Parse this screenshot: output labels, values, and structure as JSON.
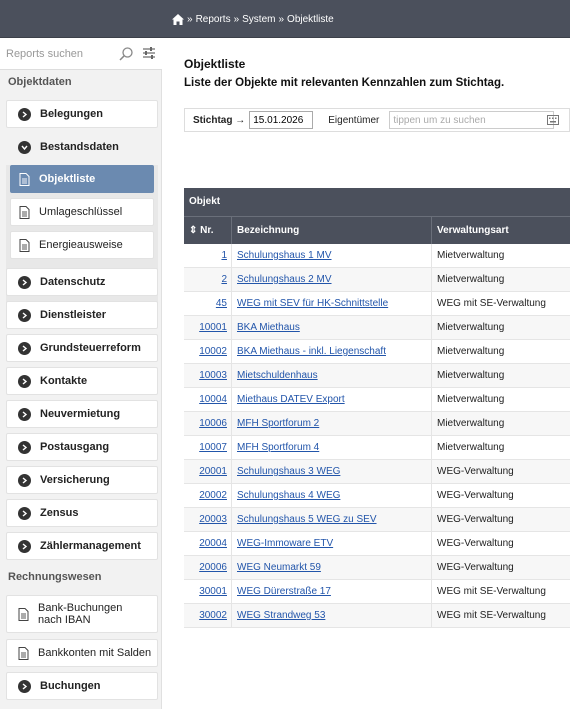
{
  "breadcrumb": {
    "items": [
      "Reports",
      "System",
      "Objektliste"
    ]
  },
  "sidebar": {
    "search_placeholder": "Reports suchen",
    "sections": {
      "objektdaten": "Objektdaten",
      "rechnungswesen": "Rechnungswesen"
    },
    "items": {
      "belegungen": "Belegungen",
      "bestandsdaten": "Bestandsdaten",
      "objektliste": "Objektliste",
      "umlageschluessel": "Umlageschlüssel",
      "energieausweise": "Energieausweise",
      "datenschutz": "Datenschutz",
      "dienstleister": "Dienstleister",
      "grundsteuerreform": "Grundsteuerreform",
      "kontakte": "Kontakte",
      "neuvermietung": "Neuvermietung",
      "postausgang": "Postausgang",
      "versicherung": "Versicherung",
      "zensus": "Zensus",
      "zaehlermanagement": "Zählermanagement",
      "bank_buchungen": "Bank-Buchungen nach IBAN",
      "bankkonten": "Bankkonten mit Salden",
      "buchungen": "Buchungen"
    }
  },
  "main": {
    "title": "Objektliste",
    "subtitle": "Liste der Objekte mit relevanten Kennzahlen zum Stichtag.",
    "filter": {
      "stichtag_label": "Stichtag →",
      "stichtag_value": "15.01.2026",
      "eigentuemer_label": "Eigentümer",
      "eigentuemer_placeholder": "tippen um zu suchen"
    },
    "table": {
      "group_label": "Objekt",
      "columns": [
        "⇕ Nr.",
        "Bezeichnung",
        "Verwaltungsart"
      ],
      "rows": [
        {
          "nr": "1",
          "name": "Schulungshaus 1 MV",
          "art": "Mietverwaltung"
        },
        {
          "nr": "2",
          "name": "Schulungshaus 2 MV",
          "art": "Mietverwaltung"
        },
        {
          "nr": "45",
          "name": "WEG mit SEV für HK-Schnittstelle",
          "art": "WEG mit SE-Verwaltung"
        },
        {
          "nr": "10001",
          "name": "BKA Miethaus",
          "art": "Mietverwaltung"
        },
        {
          "nr": "10002",
          "name": "BKA Miethaus - inkl. Liegenschaft",
          "art": "Mietverwaltung"
        },
        {
          "nr": "10003",
          "name": "Mietschuldenhaus",
          "art": "Mietverwaltung"
        },
        {
          "nr": "10004",
          "name": "Miethaus DATEV Export",
          "art": "Mietverwaltung"
        },
        {
          "nr": "10006",
          "name": "MFH Sportforum 2",
          "art": "Mietverwaltung"
        },
        {
          "nr": "10007",
          "name": "MFH Sportforum 4",
          "art": "Mietverwaltung"
        },
        {
          "nr": "20001",
          "name": "Schulungshaus 3 WEG",
          "art": "WEG-Verwaltung"
        },
        {
          "nr": "20002",
          "name": "Schulungshaus 4 WEG",
          "art": "WEG-Verwaltung"
        },
        {
          "nr": "20003",
          "name": "Schulungshaus 5 WEG zu SEV",
          "art": "WEG-Verwaltung"
        },
        {
          "nr": "20004",
          "name": "WEG-Immoware ETV",
          "art": "WEG-Verwaltung"
        },
        {
          "nr": "20006",
          "name": "WEG Neumarkt 59",
          "art": "WEG-Verwaltung"
        },
        {
          "nr": "30001",
          "name": "WEG Dürerstraße 17",
          "art": "WEG mit SE-Verwaltung"
        },
        {
          "nr": "30002",
          "name": "WEG Strandweg 53",
          "art": "WEG mit SE-Verwaltung"
        }
      ]
    }
  }
}
